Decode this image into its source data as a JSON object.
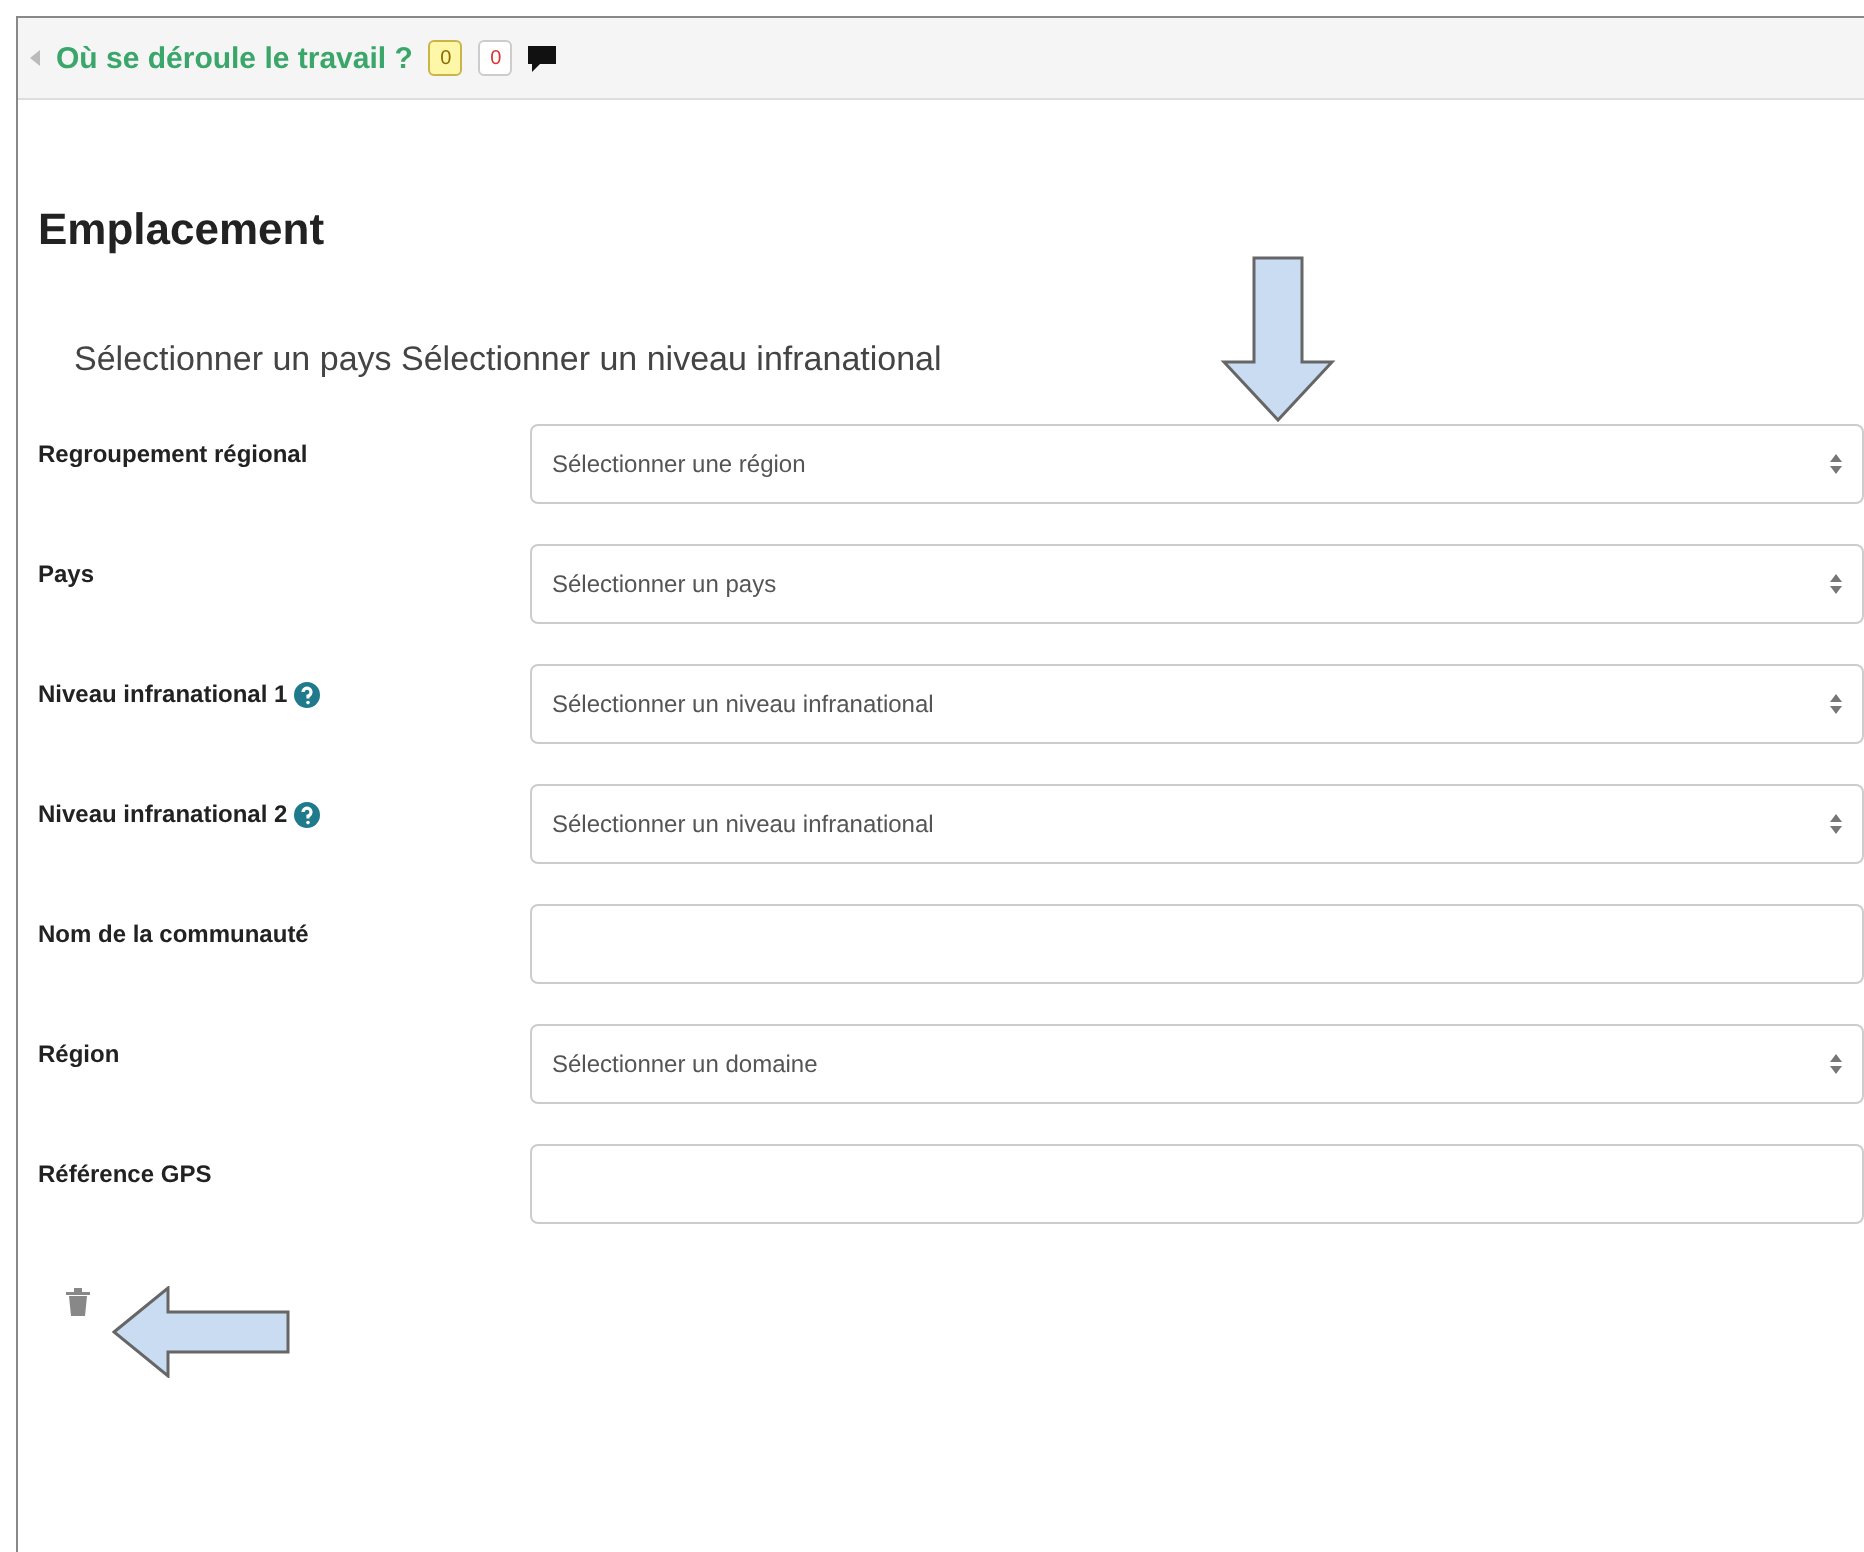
{
  "header": {
    "title": "Où se déroule le travail ?",
    "badges": [
      {
        "kind": "note",
        "text": "0"
      },
      {
        "kind": "file",
        "text": "0"
      }
    ]
  },
  "section": {
    "title": "Emplacement",
    "subtitle": "Sélectionner un pays Sélectionner un niveau infranational"
  },
  "fields": [
    {
      "label": "Regroupement régional",
      "kind": "select",
      "help": false,
      "placeholder": "Sélectionner une région"
    },
    {
      "label": "Pays",
      "kind": "select",
      "help": false,
      "placeholder": "Sélectionner un pays"
    },
    {
      "label": "Niveau infranational 1",
      "kind": "select",
      "help": true,
      "placeholder": "Sélectionner un niveau infranational"
    },
    {
      "label": "Niveau infranational 2",
      "kind": "select",
      "help": true,
      "placeholder": "Sélectionner un niveau infranational"
    },
    {
      "label": "Nom de la communauté",
      "kind": "text",
      "help": false
    },
    {
      "label": "Région",
      "kind": "select",
      "help": false,
      "placeholder": "Sélectionner un domaine"
    },
    {
      "label": "Référence GPS",
      "kind": "text",
      "help": false
    }
  ]
}
